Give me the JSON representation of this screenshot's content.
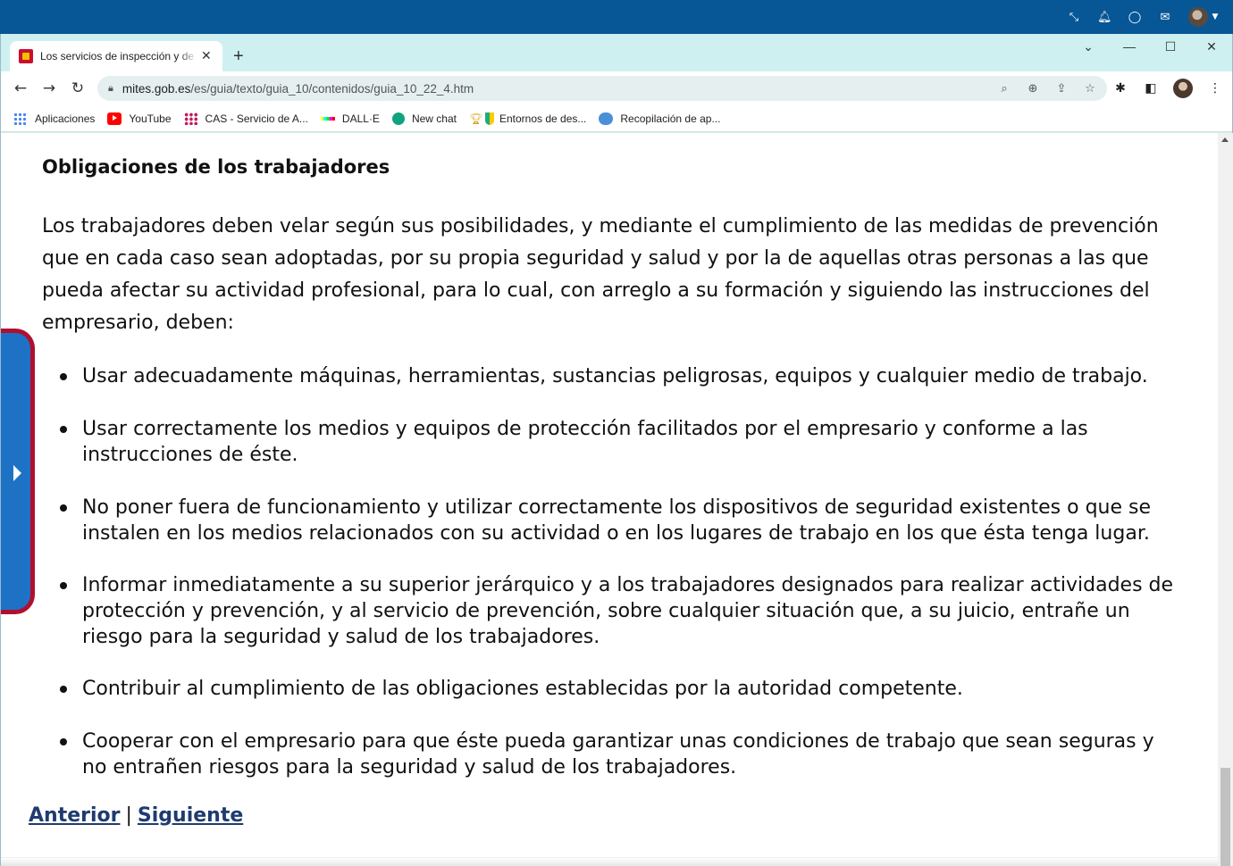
{
  "browser": {
    "tab_title": "Los servicios de inspección y de seguridad social",
    "tab_close": "✕",
    "new_tab": "+",
    "url_host": "mites.gob.es",
    "url_path": "/es/guia/texto/guia_10/contenidos/guia_10_22_4.htm",
    "bookmarks": [
      {
        "label": "Aplicaciones",
        "icon": "apps-icon"
      },
      {
        "label": "YouTube",
        "icon": "youtube-icon"
      },
      {
        "label": "CAS - Servicio de A...",
        "icon": "cas-icon"
      },
      {
        "label": "DALL·E",
        "icon": "dalle-icon"
      },
      {
        "label": "New chat",
        "icon": "chatgpt-icon"
      },
      {
        "label": "Entornos de des...",
        "icon": "trophy-shield-icon"
      },
      {
        "label": "Recopilación de ap...",
        "icon": "cloud-icon"
      }
    ]
  },
  "page": {
    "heading": "Obligaciones de los trabajadores",
    "intro": "Los trabajadores deben velar según sus posibilidades, y mediante el cumplimiento de las medidas de prevención que en cada caso sean adoptadas, por su propia seguridad y salud y por la de aquellas otras personas a las que pueda afectar su actividad profesional, para lo cual, con arreglo a su formación y siguiendo las instrucciones del empresario, deben:",
    "items": [
      "Usar adecuadamente máquinas, herramientas, sustancias peligrosas, equipos y cualquier medio de trabajo.",
      "Usar correctamente los medios y equipos de protección facilitados por el empresario y conforme a las instrucciones de éste.",
      "No poner fuera de funcionamiento y utilizar correctamente los dispositivos de seguridad existentes o que se instalen en los medios relacionados con su actividad o en los lugares de trabajo en los que ésta tenga lugar.",
      "Informar inmediatamente a su superior jerárquico y a los trabajadores designados para realizar actividades de protección y prevención, y al servicio de prevención, sobre cualquier situación que, a su juicio, entrañe un riesgo para la seguridad y salud de los trabajadores.",
      "Contribuir al cumplimiento de las obligaciones establecidas por la autoridad competente.",
      "Cooperar con el empresario para que éste pueda garantizar unas condiciones de trabajo que sean seguras y no entrañen riesgos para la seguridad y salud de los trabajadores."
    ],
    "prev_label": "Anterior",
    "separator": "|",
    "next_label": "Siguiente"
  },
  "colors": {
    "os_bar": "#075696",
    "chrome_frame": "#cff0f0",
    "link": "#1f3b6f",
    "side_tab": "#1e72c6",
    "side_tab_border": "#b01030"
  }
}
